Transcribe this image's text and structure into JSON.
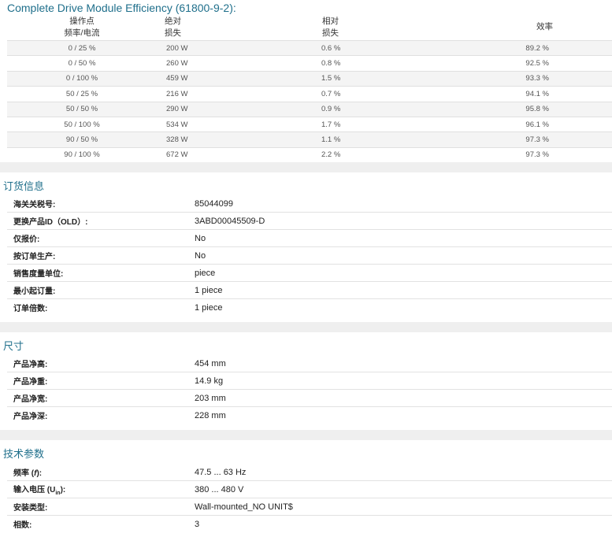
{
  "efficiency": {
    "title": "Complete Drive Module Efficiency (61800-9-2):",
    "headers": {
      "col1_line1": "操作点",
      "col1_line2": "频率/电流",
      "col2_line1": "绝对",
      "col2_line2": "损失",
      "col3_line1": "相对",
      "col3_line2": "损失",
      "col4": "效率"
    },
    "rows": [
      {
        "point": "0 / 25 %",
        "abs": "200 W",
        "rel": "0.6 %",
        "eff": "89.2 %"
      },
      {
        "point": "0 / 50 %",
        "abs": "260 W",
        "rel": "0.8 %",
        "eff": "92.5 %"
      },
      {
        "point": "0 / 100 %",
        "abs": "459 W",
        "rel": "1.5 %",
        "eff": "93.3 %"
      },
      {
        "point": "50 / 25 %",
        "abs": "216 W",
        "rel": "0.7 %",
        "eff": "94.1 %"
      },
      {
        "point": "50 / 50 %",
        "abs": "290 W",
        "rel": "0.9 %",
        "eff": "95.8 %"
      },
      {
        "point": "50 / 100 %",
        "abs": "534 W",
        "rel": "1.7 %",
        "eff": "96.1 %"
      },
      {
        "point": "90 / 50 %",
        "abs": "328 W",
        "rel": "1.1 %",
        "eff": "97.3 %"
      },
      {
        "point": "90 / 100 %",
        "abs": "672 W",
        "rel": "2.2 %",
        "eff": "97.3 %"
      }
    ]
  },
  "ordering": {
    "title": "订货信息",
    "rows": [
      {
        "label": "海关关税号:",
        "value": "85044099"
      },
      {
        "label": "更换产品ID（OLD）:",
        "value": "3ABD00045509-D"
      },
      {
        "label": "仅报价:",
        "value": "No"
      },
      {
        "label": "按订单生产:",
        "value": "No"
      },
      {
        "label": "销售度量单位:",
        "value": "piece"
      },
      {
        "label": "最小起订量:",
        "value": "1 piece"
      },
      {
        "label": "订单倍数:",
        "value": "1 piece"
      }
    ]
  },
  "dimensions": {
    "title": "尺寸",
    "rows": [
      {
        "label": "产品净高:",
        "value": "454 mm"
      },
      {
        "label": "产品净重:",
        "value": "14.9 kg"
      },
      {
        "label": "产品净宽:",
        "value": "203 mm"
      },
      {
        "label": "产品净深:",
        "value": "228 mm"
      }
    ]
  },
  "technical": {
    "title": "技术参数",
    "freq_label_pre": "频率 (",
    "freq_label_sym": "f",
    "freq_label_post": "):",
    "freq_value": "47.5 ... 63 Hz",
    "volt_label_pre": "输入电压 (U",
    "volt_label_sub": "in",
    "volt_label_post": "):",
    "volt_value": "380 ... 480 V",
    "mount_label": "安装类型:",
    "mount_value": "Wall-mounted_NO UNIT$",
    "phase_label": "相数:",
    "phase_value": "3"
  },
  "colors": {
    "accent": "#1f6f8b",
    "band": "#efefef",
    "row_alt": "#f4f4f4"
  }
}
